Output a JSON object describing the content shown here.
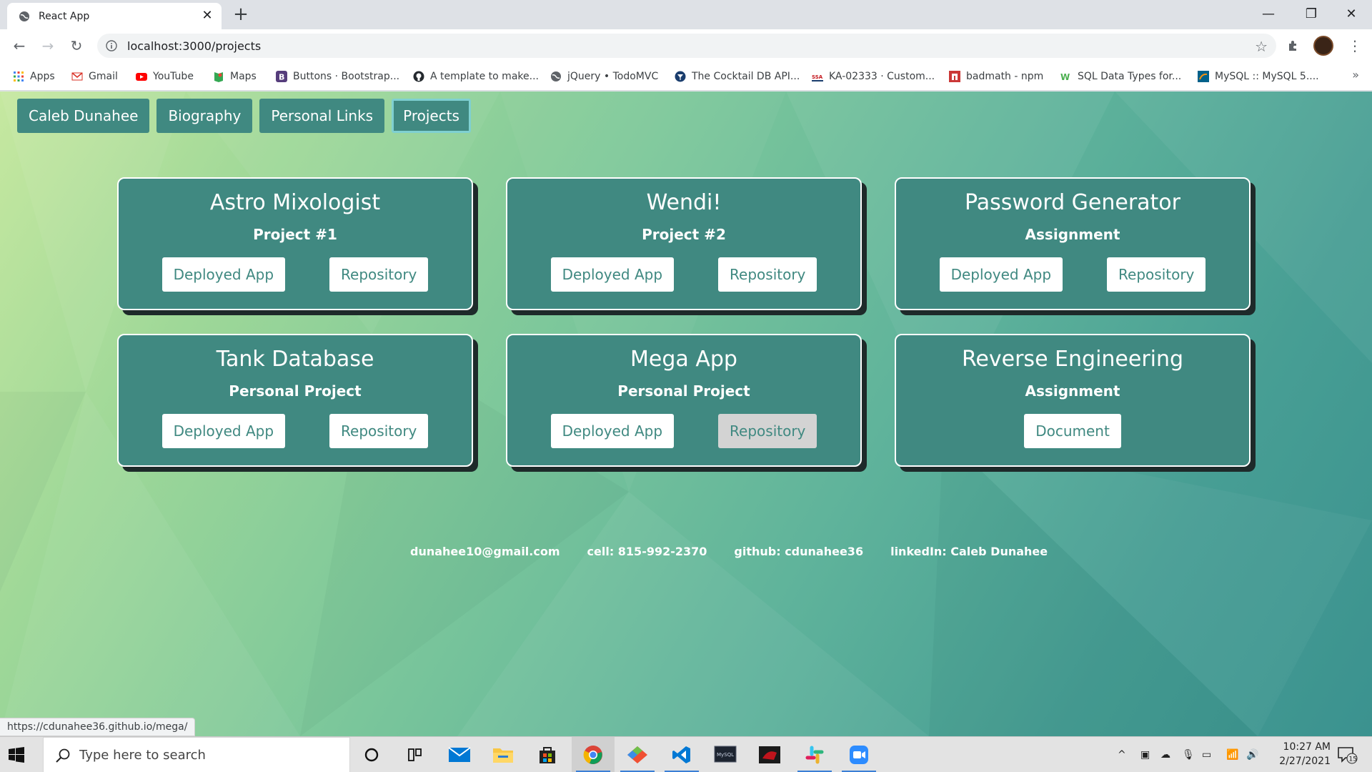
{
  "browser": {
    "tab_title": "React App",
    "url": "localhost:3000/projects",
    "status_url": "https://cdunahee36.github.io/mega/",
    "bookmarks": [
      {
        "label": "Apps",
        "icon": "apps-grid-icon",
        "color": "#4285f4"
      },
      {
        "label": "Gmail",
        "icon": "gmail-icon",
        "color": "#d93025"
      },
      {
        "label": "YouTube",
        "icon": "youtube-icon",
        "color": "#ff0000"
      },
      {
        "label": "Maps",
        "icon": "maps-icon",
        "color": "#34a853"
      },
      {
        "label": "Buttons · Bootstrap...",
        "icon": "bootstrap-icon",
        "color": "#563d7c"
      },
      {
        "label": "A template to make...",
        "icon": "github-icon",
        "color": "#24292e"
      },
      {
        "label": "jQuery • TodoMVC",
        "icon": "globe-icon",
        "color": "#5f6368"
      },
      {
        "label": "The Cocktail DB API...",
        "icon": "cocktaildb-icon",
        "color": "#1a3d6d"
      },
      {
        "label": "KA-02333 · Custom...",
        "icon": "ssa-icon",
        "color": "#c4161c"
      },
      {
        "label": "badmath - npm",
        "icon": "npm-icon",
        "color": "#cb3837"
      },
      {
        "label": "SQL Data Types for...",
        "icon": "w3schools-icon",
        "color": "#4caf50"
      },
      {
        "label": "MySQL :: MySQL 5....",
        "icon": "mysql-icon",
        "color": "#00618a"
      }
    ]
  },
  "nav": {
    "items": [
      "Caleb Dunahee",
      "Biography",
      "Personal Links",
      "Projects"
    ],
    "active": "Projects"
  },
  "projects": [
    {
      "title": "Astro Mixologist",
      "subtitle": "Project #1",
      "buttons": [
        "Deployed App",
        "Repository"
      ]
    },
    {
      "title": "Wendi!",
      "subtitle": "Project #2",
      "buttons": [
        "Deployed App",
        "Repository"
      ]
    },
    {
      "title": "Password Generator",
      "subtitle": "Assignment",
      "buttons": [
        "Deployed App",
        "Repository"
      ]
    },
    {
      "title": "Tank Database",
      "subtitle": "Personal Project",
      "buttons": [
        "Deployed App",
        "Repository"
      ]
    },
    {
      "title": "Mega App",
      "subtitle": "Personal Project",
      "buttons": [
        "Deployed App",
        "Repository"
      ]
    },
    {
      "title": "Reverse Engineering",
      "subtitle": "Assignment",
      "buttons": [
        "Document"
      ]
    }
  ],
  "footer": {
    "email": "dunahee10@gmail.com",
    "cell": "cell: 815-992-2370",
    "github": "github: cdunahee36",
    "linkedin": "linkedIn: Caleb Dunahee"
  },
  "taskbar": {
    "search_placeholder": "Type here to search",
    "time": "10:27 AM",
    "date": "2/27/2021",
    "notifications": "15",
    "apps": [
      "cortana-icon",
      "task-view-icon",
      "mail-icon",
      "file-explorer-icon",
      "store-icon",
      "chrome-icon",
      "git-icon",
      "vscode-icon",
      "mysql-workbench-icon",
      "game-icon",
      "slack-icon",
      "zoom-icon"
    ]
  },
  "colors": {
    "accent": "#408981",
    "active_border": "#7fd0d1",
    "button_hover": "#d3d3d3"
  }
}
